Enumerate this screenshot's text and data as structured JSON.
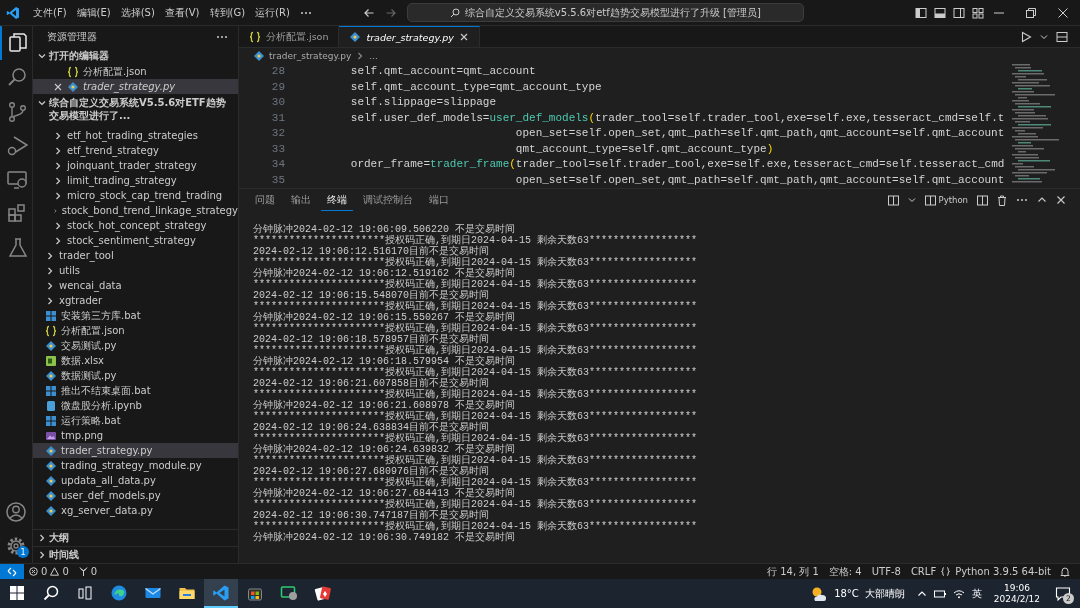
{
  "title_bar": {
    "menus": [
      "文件(F)",
      "编辑(E)",
      "选择(S)",
      "查看(V)",
      "转到(G)",
      "运行(R)"
    ],
    "command_center": "综合自定义交易系统v5.5.6对etf趋势交易模型进行了升级 [管理员]"
  },
  "activity_bar": {
    "items": [
      {
        "selected": true
      },
      {
        "selected": false
      },
      {
        "selected": false
      },
      {
        "selected": false
      },
      {
        "selected": false
      },
      {
        "selected": false
      },
      {
        "selected": false
      }
    ],
    "settings_badge": "1"
  },
  "sidebar": {
    "title": "资源管理器",
    "open_editors": {
      "title": "打开的编辑器",
      "expanded": true,
      "items": [
        {
          "label": "分析配置.json",
          "kind": "json",
          "selected": false,
          "preview": false
        },
        {
          "label": "trader_strategy.py",
          "kind": "py",
          "selected": true,
          "preview": true
        }
      ]
    },
    "workspace": {
      "title": "综合自定义交易系统V5.5.6对ETF趋势交易模型进行了...",
      "expanded": true,
      "children": [
        {
          "children": [
            {
              "label": "etf_hot_trading_strategies",
              "kind": "folder",
              "expanded": false,
              "selected": false
            },
            {
              "label": "etf_trend_strategy",
              "kind": "folder",
              "expanded": false,
              "selected": false
            },
            {
              "label": "joinquant_trader_strategy",
              "kind": "folder",
              "expanded": false,
              "selected": false
            },
            {
              "label": "limit_trading_strategy",
              "kind": "folder",
              "expanded": false,
              "selected": false
            },
            {
              "label": "micro_stock_cap_trend_trading",
              "kind": "folder",
              "expanded": false,
              "selected": false
            },
            {
              "label": "stock_bond_trend_linkage_strategy",
              "kind": "folder",
              "expanded": false,
              "selected": false
            },
            {
              "label": "stock_hot_concept_strategy",
              "kind": "folder",
              "expanded": false,
              "selected": false
            },
            {
              "label": "stock_sentiment_strategy",
              "kind": "folder",
              "expanded": false,
              "selected": false
            }
          ]
        },
        {
          "label": "trader_tool",
          "kind": "folder",
          "expanded": false,
          "selected": false
        },
        {
          "label": "utils",
          "kind": "folder",
          "expanded": false,
          "selected": false
        },
        {
          "label": "wencai_data",
          "kind": "folder",
          "expanded": false,
          "selected": false
        },
        {
          "label": "xgtrader",
          "kind": "folder",
          "expanded": false,
          "selected": false
        },
        {
          "label": "安装第三方库.bat",
          "kind": "bat",
          "selected": false
        },
        {
          "label": "分析配置.json",
          "kind": "json",
          "selected": false
        },
        {
          "label": "交易测试.py",
          "kind": "py",
          "selected": false
        },
        {
          "label": "数据.xlsx",
          "kind": "xlsx",
          "selected": false
        },
        {
          "label": "数据测试.py",
          "kind": "py",
          "selected": false
        },
        {
          "label": "推出不结束桌面.bat",
          "kind": "bat",
          "selected": false
        },
        {
          "label": "微盘股分析.ipynb",
          "kind": "ipynb",
          "selected": false
        },
        {
          "label": "运行策略.bat",
          "kind": "bat",
          "selected": false
        },
        {
          "label": "tmp.png",
          "kind": "png",
          "selected": false
        },
        {
          "label": "trader_strategy.py",
          "kind": "py",
          "selected": true
        },
        {
          "label": "trading_strategy_module.py",
          "kind": "py",
          "selected": false
        },
        {
          "label": "updata_all_data.py",
          "kind": "py",
          "selected": false
        },
        {
          "label": "user_def_models.py",
          "kind": "py",
          "selected": false
        },
        {
          "label": "xg_server_data.py",
          "kind": "py",
          "selected": false
        }
      ]
    },
    "sections": [
      {
        "title": "大纲",
        "expanded": false
      },
      {
        "title": "时间线",
        "expanded": false
      }
    ]
  },
  "editor": {
    "tabs": [
      {
        "label": "分析配置.json",
        "kind": "json",
        "selected": false,
        "preview": false
      },
      {
        "label": "trader_strategy.py",
        "kind": "py",
        "selected": true,
        "preview": true
      }
    ],
    "breadcrumb": [
      "trader_strategy.py",
      "..."
    ],
    "code": [
      {
        "number": "28",
        "tokens": [
          {
            "kind": "plain",
            "text": "        self.qmt_account=qmt_account"
          }
        ]
      },
      {
        "number": "29",
        "tokens": [
          {
            "kind": "plain",
            "text": "        self.qmt_account_type=qmt_account_type"
          }
        ]
      },
      {
        "number": "30",
        "tokens": [
          {
            "kind": "plain",
            "text": "        self.slippage=slippage"
          }
        ]
      },
      {
        "number": "31",
        "tokens": [
          {
            "kind": "plain",
            "text": "        self.user_def_models="
          },
          {
            "kind": "function",
            "text": "user_def_models"
          },
          {
            "kind": "bracket",
            "text": "("
          },
          {
            "kind": "plain",
            "text": "trader_tool=self.trader_tool,exe=self.exe,tesseract_cmd=self.t"
          }
        ]
      },
      {
        "number": "32",
        "tokens": [
          {
            "kind": "plain",
            "text": "                                 open_set=self.open_set,qmt_path=self.qmt_path,qmt_account=self.qmt_account"
          }
        ]
      },
      {
        "number": "33",
        "tokens": [
          {
            "kind": "plain",
            "text": "                                 qmt_account_type=self.qmt_account_type"
          },
          {
            "kind": "bracket",
            "text": ")"
          }
        ]
      },
      {
        "number": "34",
        "tokens": [
          {
            "kind": "plain",
            "text": "        order_frame="
          },
          {
            "kind": "function",
            "text": "trader_frame"
          },
          {
            "kind": "bracket",
            "text": "("
          },
          {
            "kind": "plain",
            "text": "trader_tool=self.trader_tool,exe=self.exe,tesseract_cmd=self.tesseract_cmd"
          }
        ]
      },
      {
        "number": "35",
        "tokens": [
          {
            "kind": "plain",
            "text": "                                 open_set=self.open_set,qmt_path=self.qmt_path,qmt_account=self.qmt_account"
          }
        ]
      }
    ]
  },
  "panel": {
    "tabs": [
      {
        "label": "问题",
        "selected": false
      },
      {
        "label": "输出",
        "selected": false
      },
      {
        "label": "终端",
        "selected": true
      },
      {
        "label": "调试控制台",
        "selected": false
      },
      {
        "label": "端口",
        "selected": false
      }
    ],
    "terminal_name": "Python",
    "lines": [
      "分钟脉冲2024-02-12 19:06:09.506220 不是交易时间",
      "**********************授权码正确,到期日2024-04-15 剩余天数63******************",
      "2024-02-12 19:06:12.516170目前不是交易时间",
      "**********************授权码正确,到期日2024-04-15 剩余天数63******************",
      "分钟脉冲2024-02-12 19:06:12.519162 不是交易时间",
      "**********************授权码正确,到期日2024-04-15 剩余天数63******************",
      "2024-02-12 19:06:15.548070目前不是交易时间",
      "**********************授权码正确,到期日2024-04-15 剩余天数63******************",
      "分钟脉冲2024-02-12 19:06:15.550267 不是交易时间",
      "**********************授权码正确,到期日2024-04-15 剩余天数63******************",
      "2024-02-12 19:06:18.578957目前不是交易时间",
      "**********************授权码正确,到期日2024-04-15 剩余天数63******************",
      "分钟脉冲2024-02-12 19:06:18.579954 不是交易时间",
      "**********************授权码正确,到期日2024-04-15 剩余天数63******************",
      "2024-02-12 19:06:21.607858目前不是交易时间",
      "**********************授权码正确,到期日2024-04-15 剩余天数63******************",
      "分钟脉冲2024-02-12 19:06:21.608978 不是交易时间",
      "**********************授权码正确,到期日2024-04-15 剩余天数63******************",
      "2024-02-12 19:06:24.638834目前不是交易时间",
      "**********************授权码正确,到期日2024-04-15 剩余天数63******************",
      "分钟脉冲2024-02-12 19:06:24.639832 不是交易时间",
      "**********************授权码正确,到期日2024-04-15 剩余天数63******************",
      "2024-02-12 19:06:27.680976目前不是交易时间",
      "**********************授权码正确,到期日2024-04-15 剩余天数63******************",
      "分钟脉冲2024-02-12 19:06:27.684413 不是交易时间",
      "**********************授权码正确,到期日2024-04-15 剩余天数63******************",
      "2024-02-12 19:06:30.747187目前不是交易时间",
      "**********************授权码正确,到期日2024-04-15 剩余天数63******************",
      "分钟脉冲2024-02-12 19:06:30.749182 不是交易时间"
    ]
  },
  "status_bar": {
    "errors": "0",
    "warnings": "0",
    "ports": "0",
    "items": [
      "行 14, 列 1",
      "空格: 4",
      "UTF-8",
      "CRLF",
      "Python 3.9.5 64-bit"
    ]
  },
  "taskbar": {
    "apps": [
      {
        "selected": false
      },
      {
        "selected": false
      },
      {
        "selected": false
      },
      {
        "selected": true
      },
      {
        "selected": false
      },
      {
        "selected": false
      },
      {
        "selected": false
      }
    ],
    "weather": {
      "temperature": "18°C",
      "condition": "大部晴朗"
    },
    "input_method": "英",
    "time": "19:06",
    "date": "2024/2/12",
    "notifications": "2"
  }
}
